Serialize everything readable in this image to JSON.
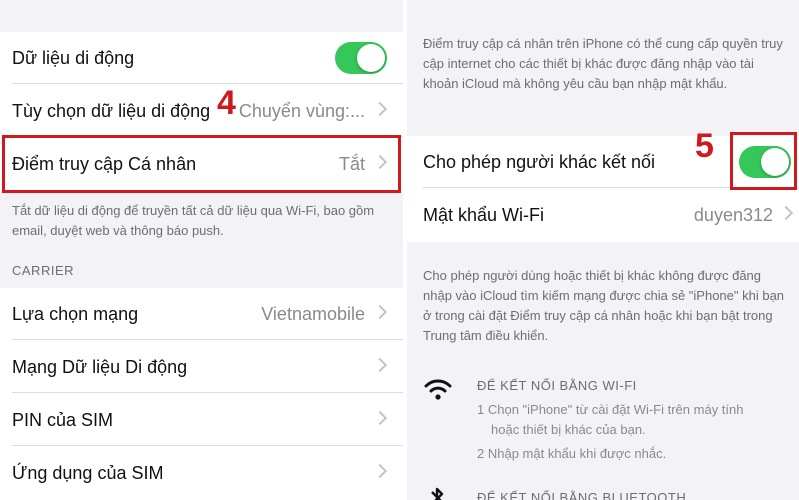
{
  "colors": {
    "toggle_on": "#34c759",
    "highlight": "#d0181f"
  },
  "left": {
    "rows": [
      {
        "label": "Dữ liệu di động",
        "value": "",
        "toggle": true
      },
      {
        "label": "Tùy chọn dữ liệu di động",
        "value": "Chuyển vùng:..."
      },
      {
        "label": "Điểm truy cập Cá nhân",
        "value": "Tắt"
      }
    ],
    "note": "Tắt dữ liệu di động để truyền tất cả dữ liệu qua Wi-Fi, bao gồm email, duyệt web và thông báo push.",
    "carrier_header": "CARRIER",
    "carrier_rows": [
      {
        "label": "Lựa chọn mạng",
        "value": "Vietnamobile"
      },
      {
        "label": "Mạng Dữ liệu Di động",
        "value": ""
      },
      {
        "label": "PIN của SIM",
        "value": ""
      },
      {
        "label": "Ứng dụng của SIM",
        "value": ""
      }
    ],
    "step_number": "4"
  },
  "right": {
    "intro": "Điểm truy cập cá nhân trên iPhone có thể cung cấp quyền truy cập internet cho các thiết bị khác được đăng nhập vào tài khoản iCloud mà không yêu cầu bạn nhập mật khẩu.",
    "allow_label": "Cho phép người khác kết nối",
    "allow_toggle": true,
    "wifi_password_label": "Mật khẩu Wi-Fi",
    "wifi_password_value": "duyen312",
    "note": "Cho phép người dùng hoặc thiết bị khác không được đăng nhập vào iCloud tìm kiếm mạng được chia sẻ \"iPhone\" khi bạn ở trong cài đặt Điểm truy cập cá nhân hoặc khi bạn bật trong Trung tâm điều khiển.",
    "wifi_section": {
      "header": "ĐỂ KẾT NỐI BẰNG WI-FI",
      "step1": "1 Chọn \"iPhone\" từ cài đặt Wi-Fi trên máy tính",
      "step1b": "hoặc thiết bị khác của bạn.",
      "step2": "2 Nhập mật khẩu khi được nhắc."
    },
    "bluetooth_header": "ĐỂ KẾT NỐI BẰNG BLUETOOTH",
    "step_number": "5"
  }
}
